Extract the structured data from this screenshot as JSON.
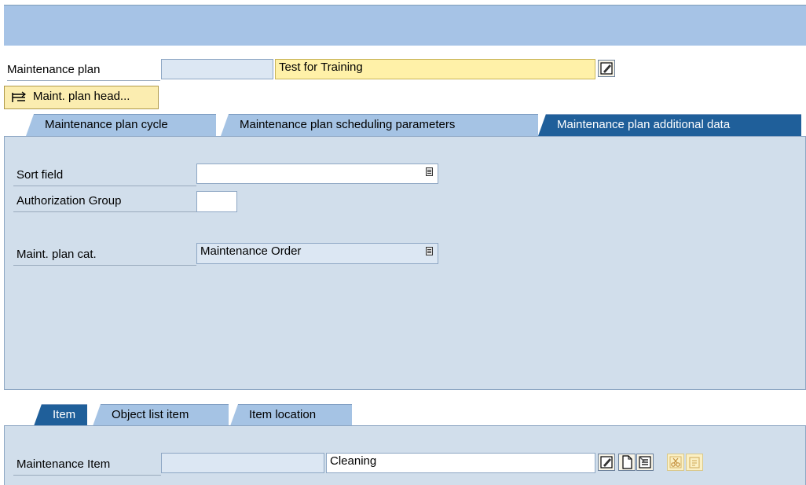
{
  "header": {
    "plan_label": "Maintenance plan",
    "plan_number": "",
    "plan_text": "Test for Training",
    "header_button": "Maint. plan head..."
  },
  "tabs": [
    {
      "label": "Maintenance plan cycle"
    },
    {
      "label": "Maintenance plan scheduling parameters"
    },
    {
      "label": "Maintenance plan additional data"
    }
  ],
  "additional_data": {
    "sort_field_label": "Sort field",
    "sort_field_value": "",
    "auth_group_label": "Authorization Group",
    "auth_group_value": "",
    "plan_cat_label": "Maint. plan cat.",
    "plan_cat_value": "Maintenance Order"
  },
  "item_tabs": [
    {
      "label": "Item"
    },
    {
      "label": "Object list item"
    },
    {
      "label": "Item location"
    }
  ],
  "item": {
    "label": "Maintenance Item",
    "number": "",
    "text": "Cleaning"
  },
  "icons": {
    "edit": "edit-icon",
    "new": "create-document-icon",
    "select": "select-item-icon",
    "cut": "cut-icon",
    "paste": "paste-icon"
  },
  "colors": {
    "toolbar": "#a6c3e6",
    "active_tab": "#1f5f9a",
    "inactive_tab": "#a5c3e4",
    "panel": "#d1deeb",
    "key_field": "#fff1a8"
  }
}
